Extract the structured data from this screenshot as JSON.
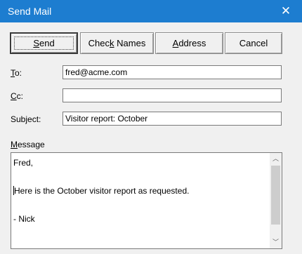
{
  "window": {
    "title": "Send Mail",
    "close_glyph": "✕"
  },
  "toolbar": {
    "send": {
      "pre": "",
      "key": "S",
      "post": "end"
    },
    "check_names": {
      "pre": "Chec",
      "key": "k",
      "post": " Names"
    },
    "address": {
      "pre": "",
      "key": "A",
      "post": "ddress"
    },
    "cancel": {
      "pre": "Cancel",
      "key": "",
      "post": ""
    }
  },
  "form": {
    "to": {
      "label_key": "T",
      "label_rest": "o:",
      "value": "fred@acme.com"
    },
    "cc": {
      "label_key": "C",
      "label_rest": "c:",
      "value": ""
    },
    "subject": {
      "label": "Subject:",
      "value": "Visitor report: October"
    },
    "message": {
      "label_key": "M",
      "label_rest": "essage",
      "lines": [
        "Fred,",
        "",
        "Here is the October visitor report as requested.",
        "",
        "- Nick"
      ]
    }
  },
  "scrollbar": {
    "up_glyph": "︿",
    "down_glyph": "﹀"
  },
  "icons": {
    "close": "close-icon",
    "scroll_up": "chevron-up-icon",
    "scroll_down": "chevron-down-icon"
  }
}
